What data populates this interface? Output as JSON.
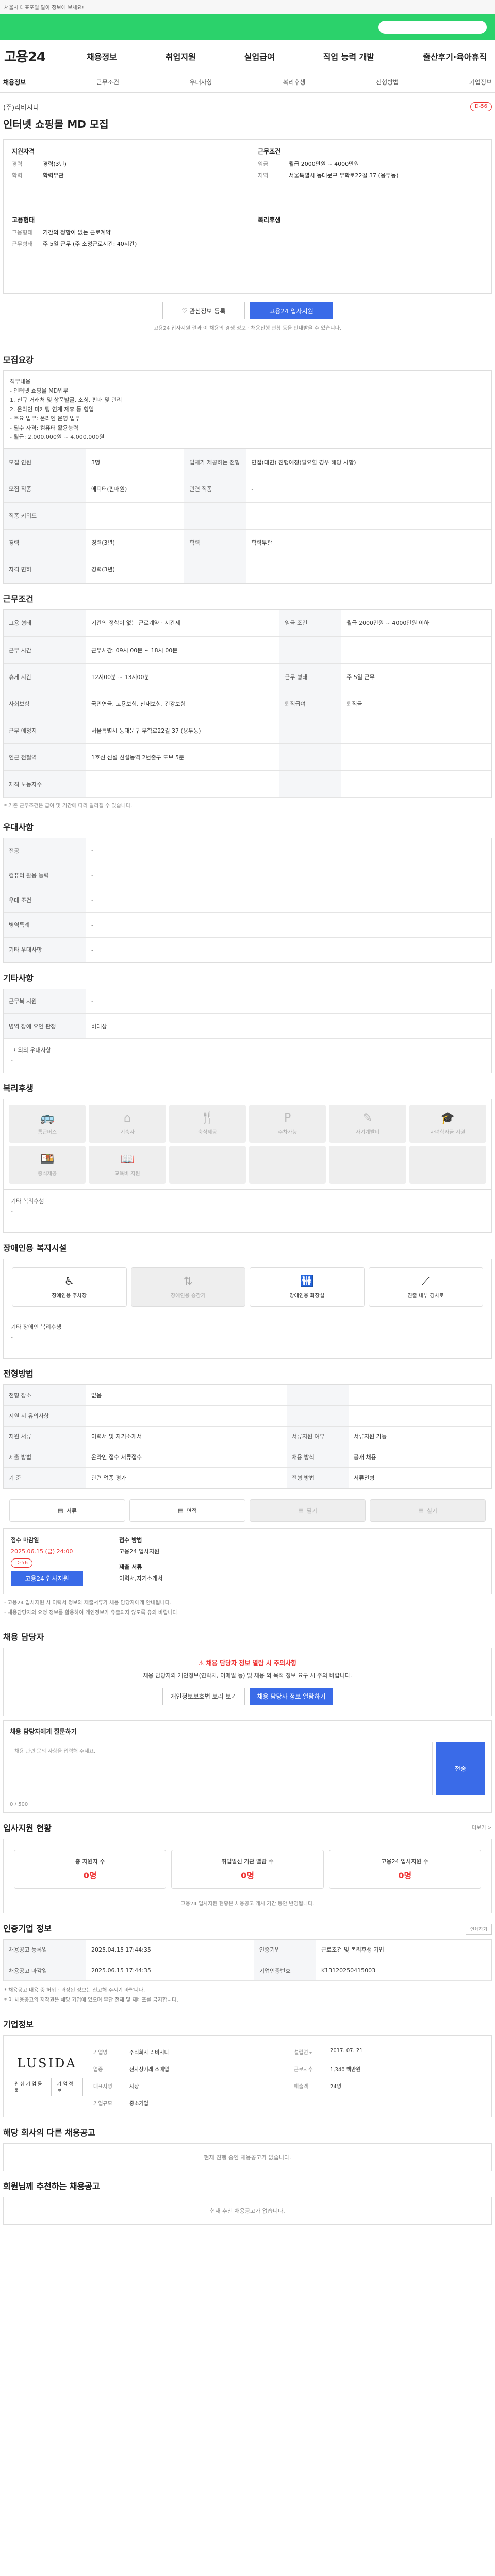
{
  "top": {
    "notice": "서울시 대표포털 알아 정보에 보세요!",
    "app_title": "고용24",
    "search_placeholder": ""
  },
  "nav": {
    "items": [
      "채용정보",
      "취업지원",
      "실업급여",
      "직업 능력 개발",
      "출산후기·육아휴직"
    ]
  },
  "subtabs": [
    "채용정보",
    "근무조건",
    "우대사항",
    "복리후생",
    "전형방법",
    "기업정보"
  ],
  "job": {
    "company": "(주)리비시다",
    "title": "인터넷 쇼핑몰 MD 모집",
    "dday": "D-56"
  },
  "summary": {
    "left_title": "지원자격",
    "left": [
      {
        "k": "경력",
        "v": "경력(3년)"
      },
      {
        "k": "학력",
        "v": "학력무관"
      }
    ],
    "left2_title": "고용형태",
    "left2": [
      {
        "k": "고용형태",
        "v": "기간의 정함이 없는 근로계약"
      },
      {
        "k": "근무형태",
        "v": "주 5일 근무 (주 소정근로시간: 40시간)"
      }
    ],
    "right_title": "근무조건",
    "right": [
      {
        "k": "임금",
        "v": "월급 2000만원 ~ 4000만원"
      },
      {
        "k": "지역",
        "v": "서울특별시 동대문구 무학로22길 37 (용두동)"
      }
    ],
    "right2_title": "복리후생"
  },
  "buttons": {
    "interest": "관심정보 등록",
    "apply": "고용24 입사지원"
  },
  "notes": {
    "apply_note": "고용24 입사지원 결과 이 채용의 경쟁 정보 · 채용진행 현황 등을 안내받을 수 있습니다."
  },
  "sections": {
    "recruit": "모집요강",
    "conditions": "근무조건",
    "pref": "우대사항",
    "etc": "기타사항",
    "welfare": "복리후생",
    "barrier": "장애인용 복지시설",
    "selection": "전형방법",
    "apply": "채용 담당자",
    "status": "입사지원 현황",
    "status_more": "더보기 >",
    "period": "인증기업 정보",
    "company": "기업정보",
    "related": "해당 회사의 다른 채용공고",
    "recommend": "회원님께 추천하는 채용공고"
  },
  "recruit": {
    "desc": [
      "직무내용",
      "- 인터넷 쇼핑몰 MD업무",
      "1. 신규 거래처 및 상품발굴, 소싱, 판매 및 관리",
      "2. 온라인 마케팅 연계 제휴 등 협업",
      "- 주요 업무: 온라인 운영 업무",
      "- 필수 자격: 컴퓨터 활용능력",
      "- 월급: 2,000,000원 ~ 4,000,000원"
    ],
    "rows": [
      {
        "k": "모집 인원",
        "v": "3명",
        "k2": "업체가 제공하는 전형",
        "v2": "면접(대면) 진행예정(필요할 경우 해당 사항)"
      },
      {
        "k": "모집 직종",
        "v": "에디터(판매원)",
        "k2": "관련 직종",
        "v2": "-"
      },
      {
        "k": "직종 키워드",
        "v": "",
        "k2": "",
        "v2": ""
      },
      {
        "k": "경력",
        "v": "경력(3년)",
        "k2": "학력",
        "v2": "학력무관"
      },
      {
        "k": "자격 면허",
        "v": "경력(3년)",
        "k2": "",
        "v2": ""
      }
    ]
  },
  "conditions": {
    "rows": [
      {
        "k": "고용 형태",
        "v": "기간의 정함이 없는 근로계약 · 시간제",
        "k2": "임금 조건",
        "v2": "월급 2000만원 ~ 4000만원 이하"
      },
      {
        "k": "근무 시간",
        "v": "근무시간: 09시 00분 ~ 18시 00분",
        "k2": "",
        "v2": ""
      },
      {
        "k": "휴게 시간",
        "v": "12시00분 ~ 13시00분",
        "k2": "근무 형태",
        "v2": "주 5일 근무"
      },
      {
        "k": "사회보험",
        "v": "국민연금, 고용보험, 산재보험, 건강보험",
        "k2": "퇴직급여",
        "v2": "퇴직금"
      },
      {
        "k": "근무 예정지",
        "v": "서울특별시 동대문구 무학로22길 37 (용두동)",
        "k2": "",
        "v2": ""
      },
      {
        "k": "인근 전철역",
        "v": "1호선 신설 신설동역 2번출구 도보 5분",
        "k2": "",
        "v2": ""
      },
      {
        "k": "재직 노동자수",
        "v": "",
        "k2": "",
        "v2": ""
      }
    ],
    "map_btn": "지도 보기",
    "foot": "* 기존 근무조건은 급여 및 기간에 따라 달라질 수 있습니다."
  },
  "pref": {
    "rows": [
      {
        "k": "전공",
        "v": "-"
      },
      {
        "k": "컴퓨터 활용 능력",
        "v": "-"
      },
      {
        "k": "우대 조건",
        "v": "-"
      },
      {
        "k": "병역특례",
        "v": "-"
      },
      {
        "k": "기타 우대사항",
        "v": "-"
      }
    ]
  },
  "etc": {
    "rows": [
      {
        "k": "근무복 지원",
        "v": "-"
      },
      {
        "k": "병역 장애 요인 판정",
        "v": "비대상"
      }
    ],
    "extra": "그 외의 우대사항",
    "extra_v": "-"
  },
  "welfare": {
    "items": [
      "통근버스",
      "기숙사",
      "숙식제공",
      "주차가능",
      "자기계발비",
      "자녀학자금 지원",
      "중식제공",
      "교육비 지원",
      "",
      "",
      "",
      ""
    ],
    "extra": "기타 복리후생",
    "extra_v": "-"
  },
  "barrier": {
    "items": [
      "장애인용 주차장",
      "장애인용 승강기",
      "장애인용 화장실",
      "진출 내부 경사로"
    ],
    "extra": "기타 장애인 복리후생",
    "extra_v": "-"
  },
  "selection": {
    "rows": [
      {
        "k": "전형 장소",
        "v": "없음",
        "k2": "",
        "v2": ""
      },
      {
        "k": "지원 시 유의사항",
        "v": "",
        "k2": "",
        "v2": ""
      },
      {
        "k": "지원 서류",
        "v": "이력서 및 자기소개서",
        "k2": "서류지원 여부",
        "v2": "서류지원 가능"
      },
      {
        "k": "제출 방법",
        "v": "온라인 접수 서류접수",
        "k2": "채용 방식",
        "v2": "공개 채용"
      },
      {
        "k": "기 준",
        "v": "관련 업종 평가",
        "k2": "전형 방법",
        "v2": "서류전형"
      }
    ],
    "methods": [
      "서류",
      "면접",
      "필기",
      "실기"
    ],
    "apply_title": "접수 마감일",
    "apply_date": "2025.06.15 (금) 24:00",
    "apply_d": "D-56",
    "apply_method_title": "접수 방법",
    "apply_method": "고용24 입사지원",
    "contact_title": "제출 서류",
    "contact_v": "이력서,자기소개서",
    "apply_btn": "고용24 입사지원",
    "notes": [
      "- 고용24 입사지원 시 이력서 정보와 제출서류가 채용 담당자에게 안내됩니다.",
      "- 채용담당자의 요청 정보를 활용하여 개인정보가 유출되지 않도록 유의 바랍니다."
    ]
  },
  "apply": {
    "warn_title": "채용 담당자 정보 열람 시 주의사항",
    "warn_text": "채용 담당자와 개인정보(연락처, 이메일 등) 및 채용 외 목적 정보 요구 시 주의 바랍니다.",
    "btn1": "개인정보보호법 보러 보기",
    "btn2": "채용 담당자 정보 열람하기",
    "qa_title": "채용 담당자에게 질문하기",
    "qa_placeholder": "채용 관련 문의 사항을 입력해 주세요.",
    "qa_btn": "전송",
    "qa_count": "0 / 500"
  },
  "status": {
    "items": [
      {
        "label": "총 지원자 수",
        "v": "0명"
      },
      {
        "label": "취업알선 기관 열람 수",
        "v": "0명"
      },
      {
        "label": "고용24 입사지원 수",
        "v": "0명"
      }
    ],
    "note": "고용24 입사지원 현황은 채용공고 게시 기간 동안 반영됩니다."
  },
  "period": {
    "rows": [
      {
        "k": "채용공고 등록일",
        "v": "2025.04.15 17:44:35",
        "k2": "인증기업",
        "v2": "근로조건 및 복리후생 기업"
      },
      {
        "k": "채용공고 마감일",
        "v": "2025.06.15 17:44:35",
        "k2": "기업인증번호",
        "v2": "K13120250415003"
      }
    ],
    "print_btn": "인쇄하기",
    "notes": [
      "* 채용공고 내용 중 허위 · 과장된 정보는 신고해 주시기 바랍니다.",
      "* 이 채용공고의 저작권은 해당 기업에 있으며 무단 전재 및 재배포를 금지합니다."
    ]
  },
  "company": {
    "logo": "LUSIDA",
    "btns": [
      "관심기업등록",
      "기업정보"
    ],
    "rows": [
      {
        "k": "기업명",
        "v": "주식회사 리비시다"
      },
      {
        "k": "설립연도",
        "v": "2017. 07. 21"
      },
      {
        "k": "업종",
        "v": "전자상거래 소매업"
      },
      {
        "k": "근로자수",
        "v": "1,340 백만원"
      },
      {
        "k": "대표자명",
        "v": "사장"
      },
      {
        "k": "매출액",
        "v": "24명"
      },
      {
        "k": "기업규모",
        "v": "중소기업"
      }
    ],
    "more": "더보기"
  },
  "related": {
    "empty": "현재 진행 중인 채용공고가 없습니다."
  },
  "recommend": {
    "empty": "현재 추천 채용공고가 없습니다."
  }
}
